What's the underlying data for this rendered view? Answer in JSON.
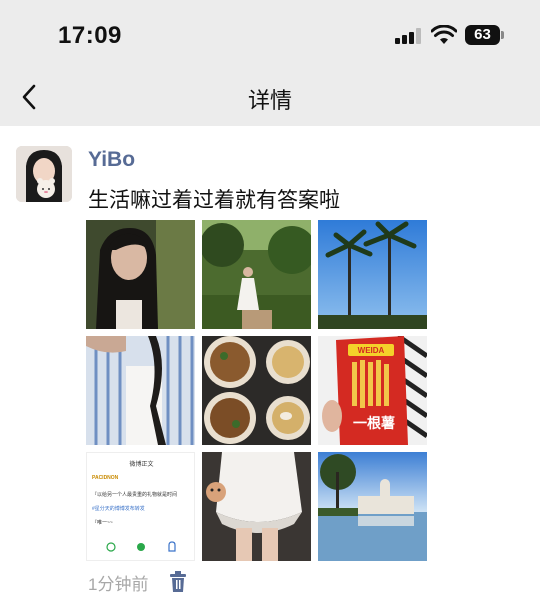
{
  "status_bar": {
    "time": "17:09",
    "battery_level": "63",
    "signal_icon": "signal-bars-icon",
    "wifi_icon": "wifi-icon"
  },
  "nav": {
    "back_icon": "chevron-left-icon",
    "title": "详情"
  },
  "post": {
    "username": "YiBo",
    "text": "生活嘛过着过着就有答案啦",
    "timestamp": "1分钟前",
    "delete_icon": "trash-icon",
    "link_color": "#576b95",
    "photos": [
      {
        "name": "photo-selfie"
      },
      {
        "name": "photo-garden-walk"
      },
      {
        "name": "photo-palm-trees"
      },
      {
        "name": "photo-striped-shirt"
      },
      {
        "name": "photo-food-table"
      },
      {
        "name": "photo-snack-pack",
        "pack_brand": "WEIDA",
        "pack_text": "一根薯"
      },
      {
        "name": "photo-weibo-screenshot",
        "title": "微博正文",
        "user": "PACIDNON",
        "line1": "『以给另一个人最贵重的礼物就是时间",
        "line2": "#星分天的博博发布转发",
        "line3": "『唯一~~"
      },
      {
        "name": "photo-white-skirt"
      },
      {
        "name": "photo-lake-building"
      }
    ]
  }
}
